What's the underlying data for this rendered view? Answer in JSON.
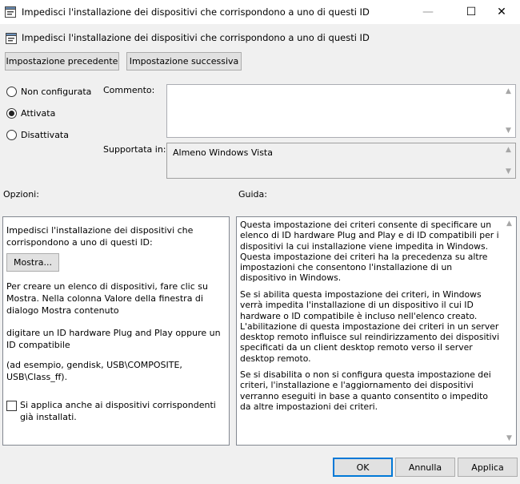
{
  "window": {
    "title": "Impedisci l'installazione dei dispositivi che corrispondono a uno di questi ID",
    "controls": {
      "minimize": "—",
      "maximize": "☐",
      "close": "✕"
    }
  },
  "header": {
    "title": "Impedisci l'installazione dei dispositivi che corrispondono a uno di questi ID",
    "icon": "policy-setting-icon"
  },
  "nav": {
    "previous_label": "Impostazione precedente",
    "next_label": "Impostazione successiva"
  },
  "state": {
    "options": [
      {
        "label": "Non configurata",
        "selected": false
      },
      {
        "label": "Attivata",
        "selected": true
      },
      {
        "label": "Disattivata",
        "selected": false
      }
    ]
  },
  "comment": {
    "label": "Commento:",
    "value": ""
  },
  "supported": {
    "label": "Supportata in:",
    "value": "Almeno Windows Vista"
  },
  "options_section": {
    "label": "Opzioni:",
    "description": "Impedisci l'installazione dei dispositivi che corrispondono a uno di questi ID:",
    "show_button": "Mostra...",
    "para1": "Per creare un elenco di dispositivi, fare clic su Mostra. Nella colonna Valore della finestra di dialogo Mostra contenuto",
    "para2": "digitare un ID hardware Plug and Play oppure un ID compatibile",
    "para3": "(ad esempio, gendisk, USB\\COMPOSITE, USB\\Class_ff).",
    "checkbox_label": "Si applica anche ai dispositivi corrispondenti già installati.",
    "checkbox_checked": false
  },
  "help_section": {
    "label": "Guida:",
    "para1": "Questa impostazione dei criteri consente di specificare un elenco di ID hardware Plug and Play e di ID compatibili per i dispositivi la cui installazione viene impedita in Windows. Questa impostazione dei criteri ha la precedenza su altre impostazioni che consentono l'installazione di un dispositivo in Windows.",
    "para2": "Se si abilita questa impostazione dei criteri, in Windows verrà impedita l'installazione di un dispositivo il cui ID hardware o ID compatibile è incluso nell'elenco creato. L'abilitazione di questa impostazione dei criteri in un server desktop remoto influisce sul reindirizzamento dei dispositivi specificati da un client desktop remoto verso il server desktop remoto.",
    "para3": "Se si disabilita o non si configura questa impostazione dei criteri, l'installazione e l'aggiornamento dei dispositivi verranno eseguiti in base a quanto consentito o impedito da altre impostazioni dei criteri."
  },
  "footer": {
    "ok_label": "OK",
    "cancel_label": "Annulla",
    "apply_label": "Applica"
  }
}
